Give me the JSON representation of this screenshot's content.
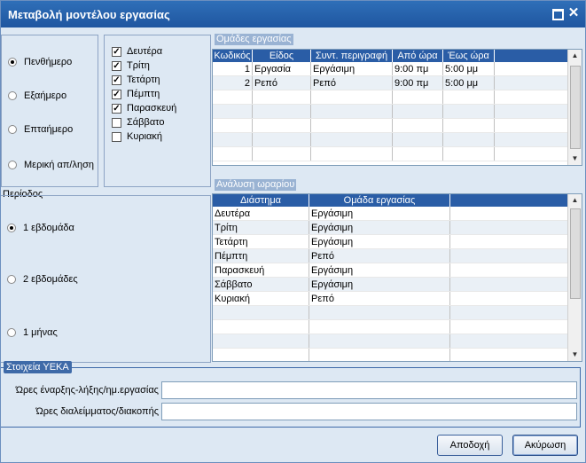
{
  "window": {
    "title": "Μεταβολή μοντέλου εργασίας"
  },
  "day_type": {
    "options": [
      "Πενθήμερο",
      "Εξαήμερο",
      "Επταήμερο",
      "Μερική απ/ληση"
    ],
    "selected": 0
  },
  "weekdays": [
    {
      "label": "Δευτέρα",
      "checked": true
    },
    {
      "label": "Τρίτη",
      "checked": true
    },
    {
      "label": "Τετάρτη",
      "checked": true
    },
    {
      "label": "Πέμπτη",
      "checked": true
    },
    {
      "label": "Παρασκευή",
      "checked": true
    },
    {
      "label": "Σάββατο",
      "checked": false
    },
    {
      "label": "Κυριακή",
      "checked": false
    }
  ],
  "work_groups": {
    "legend": "Ομάδες εργασίας",
    "columns": [
      "Κωδικός",
      "Είδος",
      "Συντ. περιγραφή",
      "Από ώρα",
      "Έως ώρα"
    ],
    "rows": [
      [
        "1",
        "Εργασία",
        "Εργάσιμη",
        "9:00 πμ",
        "5:00 μμ"
      ],
      [
        "2",
        "Ρεπό",
        "Ρεπό",
        "9:00 πμ",
        "5:00 μμ"
      ]
    ]
  },
  "period": {
    "legend": "Περίοδος",
    "options": [
      "1 εβδομάδα",
      "2 εβδομάδες",
      "1 μήνας"
    ],
    "selected": 0
  },
  "schedule": {
    "legend": "Ανάλυση ωραρίου",
    "columns": [
      "Διάστημα",
      "Ομάδα εργασίας"
    ],
    "rows": [
      [
        "Δευτέρα",
        "Εργάσιμη"
      ],
      [
        "Τρίτη",
        "Εργάσιμη"
      ],
      [
        "Τετάρτη",
        "Εργάσιμη"
      ],
      [
        "Πέμπτη",
        "Ρεπό"
      ],
      [
        "Παρασκευή",
        "Εργάσιμη"
      ],
      [
        "Σάββατο",
        "Εργάσιμη"
      ],
      [
        "Κυριακή",
        "Ρεπό"
      ]
    ]
  },
  "yeka": {
    "legend": "Στοιχεία ΥΕΚΑ",
    "start_end_label": "Ώρες έναρξης-λήξης/ημ.εργασίας",
    "start_end_value": "",
    "break_label": "Ώρες διαλείμματος/διακοπής",
    "break_value": ""
  },
  "buttons": {
    "ok": "Αποδοχή",
    "cancel": "Ακύρωση"
  }
}
